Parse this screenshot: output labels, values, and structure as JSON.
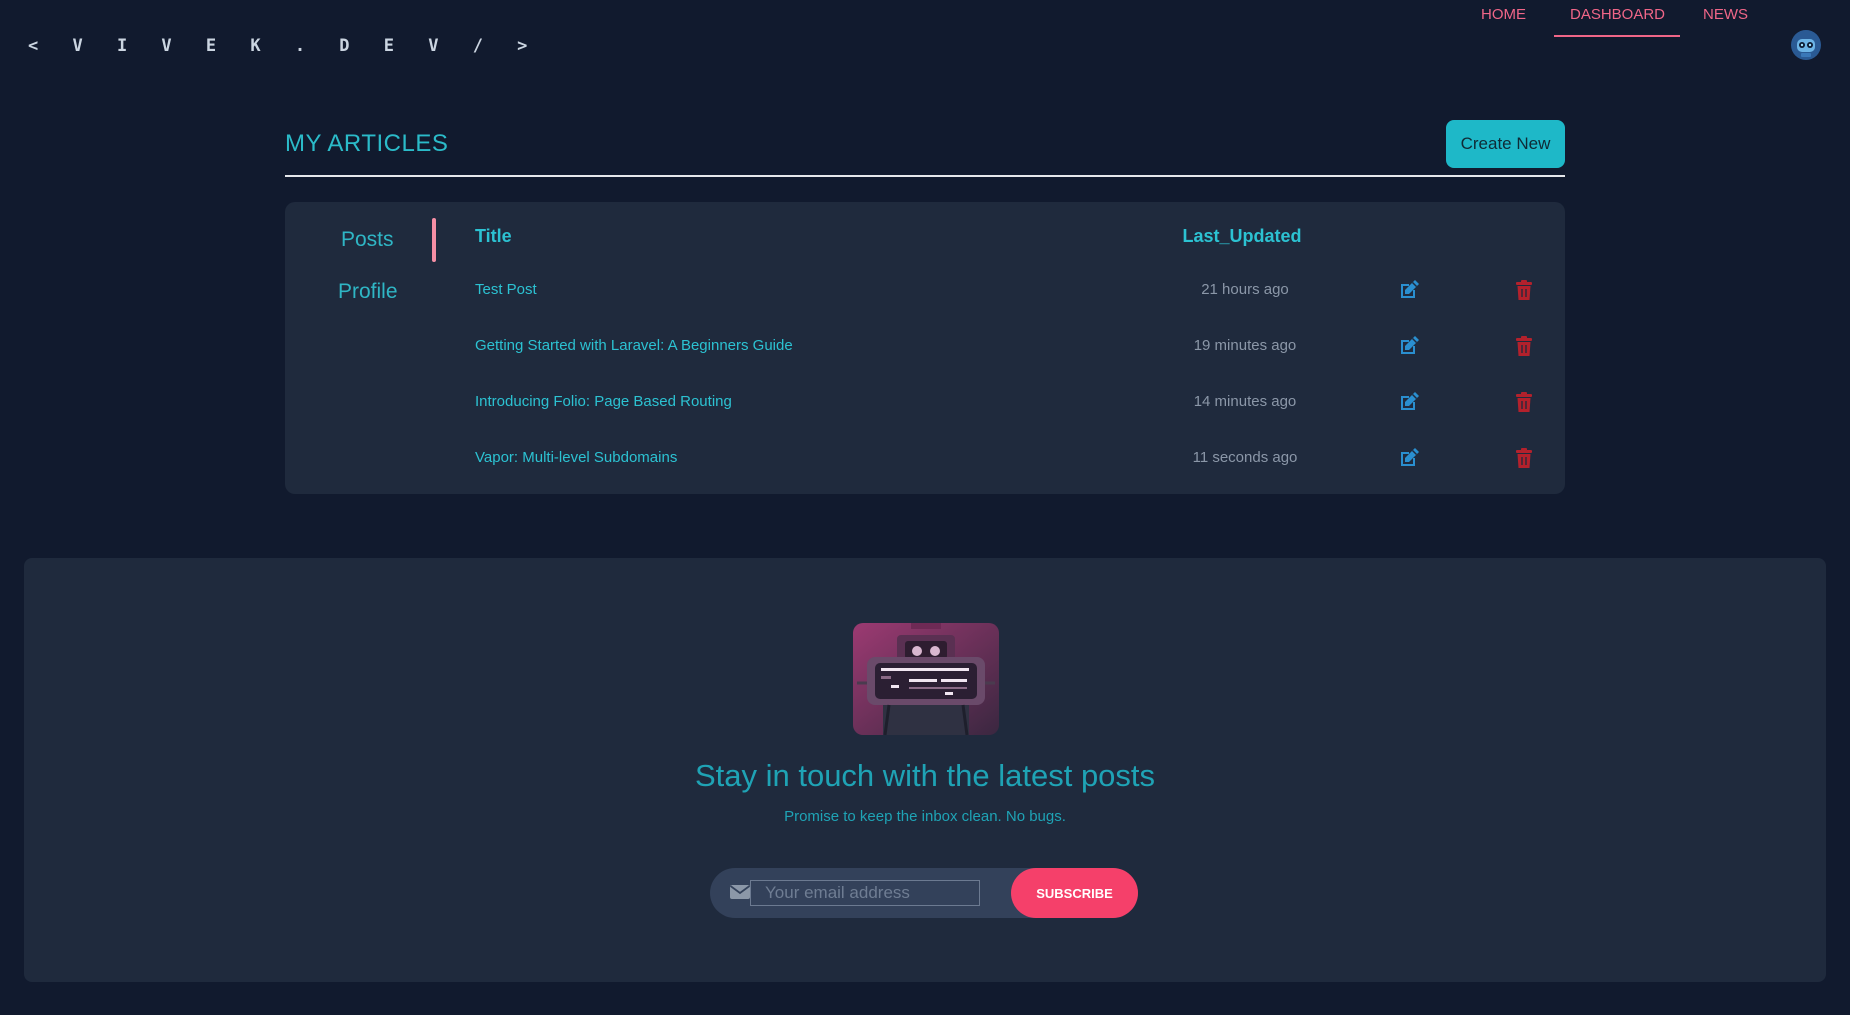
{
  "header": {
    "brand": "< V I V E K . D E V / >",
    "nav": [
      {
        "label": "HOME",
        "active": false
      },
      {
        "label": "DASHBOARD",
        "active": true
      },
      {
        "label": "NEWS",
        "active": false
      }
    ],
    "accent_color": "#f06688"
  },
  "articles": {
    "title": "MY ARTICLES",
    "create_label": "Create New",
    "sidebar": [
      "Posts",
      "Profile"
    ],
    "columns": {
      "title": "Title",
      "updated": "Last_Updated"
    },
    "rows": [
      {
        "title": "Test Post",
        "updated": "21 hours ago"
      },
      {
        "title": "Getting Started with Laravel: A Beginners Guide",
        "updated": "19 minutes ago"
      },
      {
        "title": "Introducing Folio: Page Based Routing",
        "updated": "14 minutes ago"
      },
      {
        "title": "Vapor: Multi-level Subdomains",
        "updated": "11 seconds ago"
      }
    ],
    "icons": {
      "edit": "edit-icon",
      "delete": "trash-icon"
    },
    "colors": {
      "edit": "#2a8fd0",
      "delete": "#b3212c"
    }
  },
  "newsletter": {
    "title": "Stay in touch with the latest posts",
    "subtitle": "Promise to keep the inbox clean. No bugs.",
    "input_placeholder": "Your email address",
    "button_label": "SUBSCRIBE",
    "button_color": "#f5406a"
  }
}
